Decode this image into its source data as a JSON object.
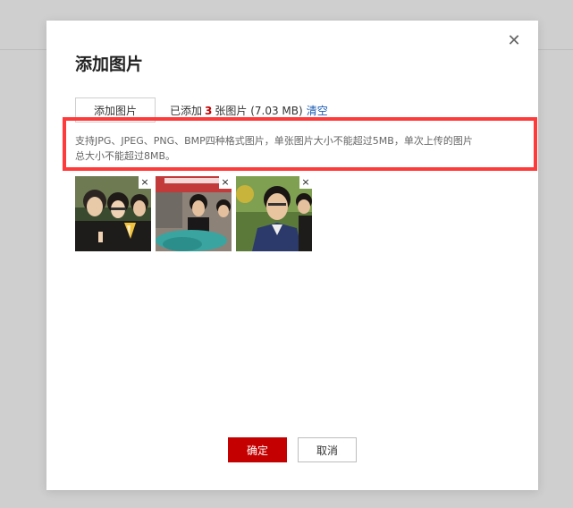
{
  "dialog": {
    "title": "添加图片",
    "close_icon": "close-icon",
    "add_button_label": "添加图片",
    "summary_prefix": "已添加",
    "count": "3",
    "summary_suffix": "张图片 (7.03 MB)",
    "clear_label": "清空",
    "hint_line1": "支持JPG、JPEG、PNG、BMP四种格式图片，单张图片大小不能超过5MB，单次上传的图片",
    "hint_line2": "总大小不能超过8MB。",
    "highlight_color": "#ff3a3a",
    "thumbnails": [
      {
        "remove_icon": "×",
        "alt": "photo-1"
      },
      {
        "remove_icon": "×",
        "alt": "photo-2"
      },
      {
        "remove_icon": "×",
        "alt": "photo-3"
      }
    ],
    "confirm_label": "确定",
    "cancel_label": "取消",
    "accent_color": "#c40000",
    "link_color": "#1a5bb3"
  }
}
